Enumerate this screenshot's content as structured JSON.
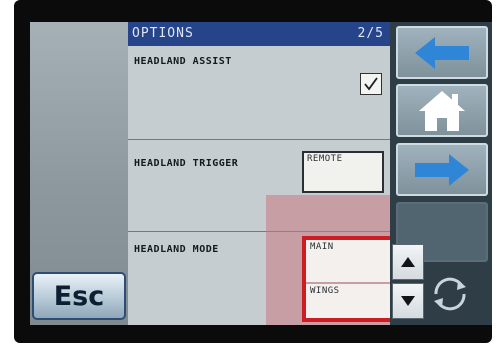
{
  "header": {
    "title": "OPTIONS",
    "page": "2/5"
  },
  "rows": [
    {
      "label": "HEADLAND ASSIST",
      "checked": true
    },
    {
      "label": "HEADLAND TRIGGER",
      "value": "REMOTE"
    },
    {
      "label": "HEADLAND MODE",
      "options": [
        "MAIN",
        "WINGS"
      ]
    }
  ],
  "esc": {
    "label": "Esc"
  },
  "nav": {
    "back_icon": "arrow-left-icon",
    "home_icon": "home-icon",
    "forward_icon": "arrow-right-icon",
    "rotate_icon": "rotate-icon"
  },
  "stepper": {
    "up_icon": "triangle-up-icon",
    "down_icon": "triangle-down-icon"
  },
  "colors": {
    "header": "#26448a",
    "arrow": "#2f86d6",
    "highlight": "#cc1d22",
    "overlay": "#c8787d"
  }
}
